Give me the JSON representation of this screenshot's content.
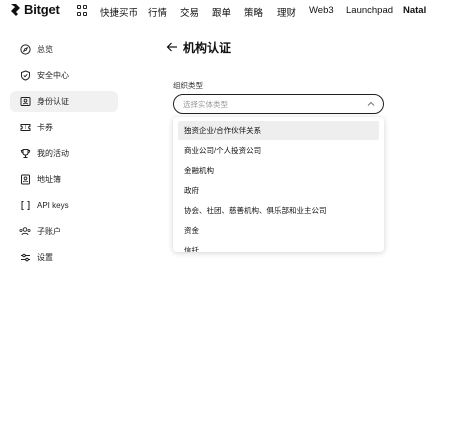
{
  "brand": {
    "name": "Bitget"
  },
  "topnav": {
    "items": [
      {
        "label": "快捷买币"
      },
      {
        "label": "行情"
      },
      {
        "label": "交易"
      },
      {
        "label": "跟单"
      },
      {
        "label": "策略"
      },
      {
        "label": "理财"
      },
      {
        "label": "Web3"
      },
      {
        "label": "Launchpad"
      },
      {
        "label": "Natal"
      }
    ]
  },
  "sidebar": {
    "items": [
      {
        "label": "总览",
        "icon": "compass-icon"
      },
      {
        "label": "安全中心",
        "icon": "shield-icon"
      },
      {
        "label": "身份认证",
        "icon": "id-card-icon",
        "active": true
      },
      {
        "label": "卡券",
        "icon": "ticket-icon"
      },
      {
        "label": "我的活动",
        "icon": "trophy-icon"
      },
      {
        "label": "地址簿",
        "icon": "address-book-icon"
      },
      {
        "label": "API keys",
        "icon": "api-icon"
      },
      {
        "label": "子账户",
        "icon": "sub-account-icon"
      },
      {
        "label": "设置",
        "icon": "settings-sliders-icon"
      }
    ]
  },
  "main": {
    "title": "机构认证",
    "field_label": "组织类型",
    "select_placeholder": "选择实体类型",
    "options": [
      {
        "label": "独资企业/合作伙伴关系",
        "highlighted": true
      },
      {
        "label": "商业公司/个人投资公司"
      },
      {
        "label": "金融机构"
      },
      {
        "label": "政府"
      },
      {
        "label": "协会、社团、慈善机构、俱乐部和业主公司"
      },
      {
        "label": "资金"
      },
      {
        "label": "信托"
      }
    ]
  },
  "colors": {
    "text": "#111111",
    "active_bg": "#f1f1f1",
    "placeholder": "#9a9a9a",
    "highlight_bg": "#eeeeee"
  }
}
